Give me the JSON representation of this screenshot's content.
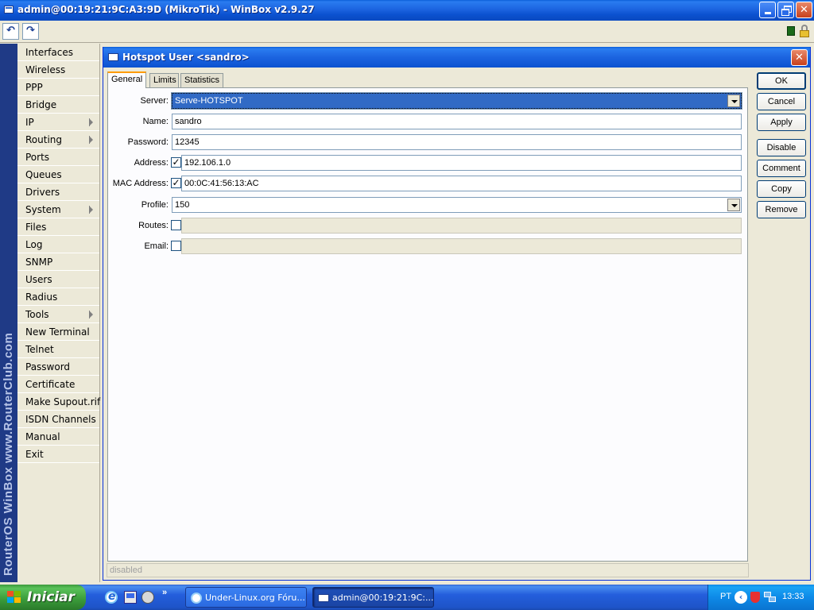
{
  "window": {
    "title": "admin@00:19:21:9C:A3:9D (MikroTik) - WinBox v2.9.27",
    "min_icon": "minimize-icon",
    "max_icon": "restore-icon",
    "close_glyph": "✕"
  },
  "toolbar": {
    "undo_glyph": "↶",
    "redo_glyph": "↷"
  },
  "brand": {
    "text": "RouterOS WinBox   www.RouterClub.com"
  },
  "menu": {
    "items": [
      {
        "label": "Interfaces",
        "submenu": false
      },
      {
        "label": "Wireless",
        "submenu": false
      },
      {
        "label": "PPP",
        "submenu": false
      },
      {
        "label": "Bridge",
        "submenu": false
      },
      {
        "label": "IP",
        "submenu": true
      },
      {
        "label": "Routing",
        "submenu": true
      },
      {
        "label": "Ports",
        "submenu": false
      },
      {
        "label": "Queues",
        "submenu": false
      },
      {
        "label": "Drivers",
        "submenu": false
      },
      {
        "label": "System",
        "submenu": true
      },
      {
        "label": "Files",
        "submenu": false
      },
      {
        "label": "Log",
        "submenu": false
      },
      {
        "label": "SNMP",
        "submenu": false
      },
      {
        "label": "Users",
        "submenu": false
      },
      {
        "label": "Radius",
        "submenu": false
      },
      {
        "label": "Tools",
        "submenu": true
      },
      {
        "label": "New Terminal",
        "submenu": false
      },
      {
        "label": "Telnet",
        "submenu": false
      },
      {
        "label": "Password",
        "submenu": false
      },
      {
        "label": "Certificate",
        "submenu": false
      },
      {
        "label": "Make Supout.rif",
        "submenu": false
      },
      {
        "label": "ISDN Channels",
        "submenu": false
      },
      {
        "label": "Manual",
        "submenu": false
      },
      {
        "label": "Exit",
        "submenu": false
      }
    ]
  },
  "dialog": {
    "title": "Hotspot User <sandro>",
    "close_glyph": "✕",
    "tabs": [
      {
        "label": "General",
        "active": true
      },
      {
        "label": "Limits",
        "active": false
      },
      {
        "label": "Statistics",
        "active": false
      }
    ],
    "fields": {
      "server": {
        "label": "Server:",
        "value": "Serve-HOTSPOT"
      },
      "name": {
        "label": "Name:",
        "value": "sandro"
      },
      "password": {
        "label": "Password:",
        "value": "12345"
      },
      "address": {
        "label": "Address:",
        "value": "192.106.1.0",
        "checked": true
      },
      "mac": {
        "label": "MAC Address:",
        "value": "00:0C:41:56:13:AC",
        "checked": true
      },
      "profile": {
        "label": "Profile:",
        "value": "150"
      },
      "routes": {
        "label": "Routes:",
        "value": "",
        "checked": false
      },
      "email": {
        "label": "Email:",
        "value": "",
        "checked": false
      }
    },
    "check_glyph": "✓",
    "buttons": {
      "ok": "OK",
      "cancel": "Cancel",
      "apply": "Apply",
      "disable": "Disable",
      "comment": "Comment",
      "copy": "Copy",
      "remove": "Remove"
    },
    "status": "disabled"
  },
  "taskbar": {
    "start_label": "Iniciar",
    "quicklaunch_more": "»",
    "tasks": [
      {
        "label": "Under-Linux.org Fóru..."
      },
      {
        "label": "admin@00:19:21:9C:..."
      }
    ],
    "tray": {
      "language": "PT",
      "chevron": "‹",
      "clock": "13:33"
    }
  },
  "colors": {
    "titlebar_blue": "#0b52d0",
    "brand_strip": "#1f3a86",
    "selection": "#316ac5",
    "start_green": "#3a9a3a",
    "close_red": "#c8401c"
  }
}
